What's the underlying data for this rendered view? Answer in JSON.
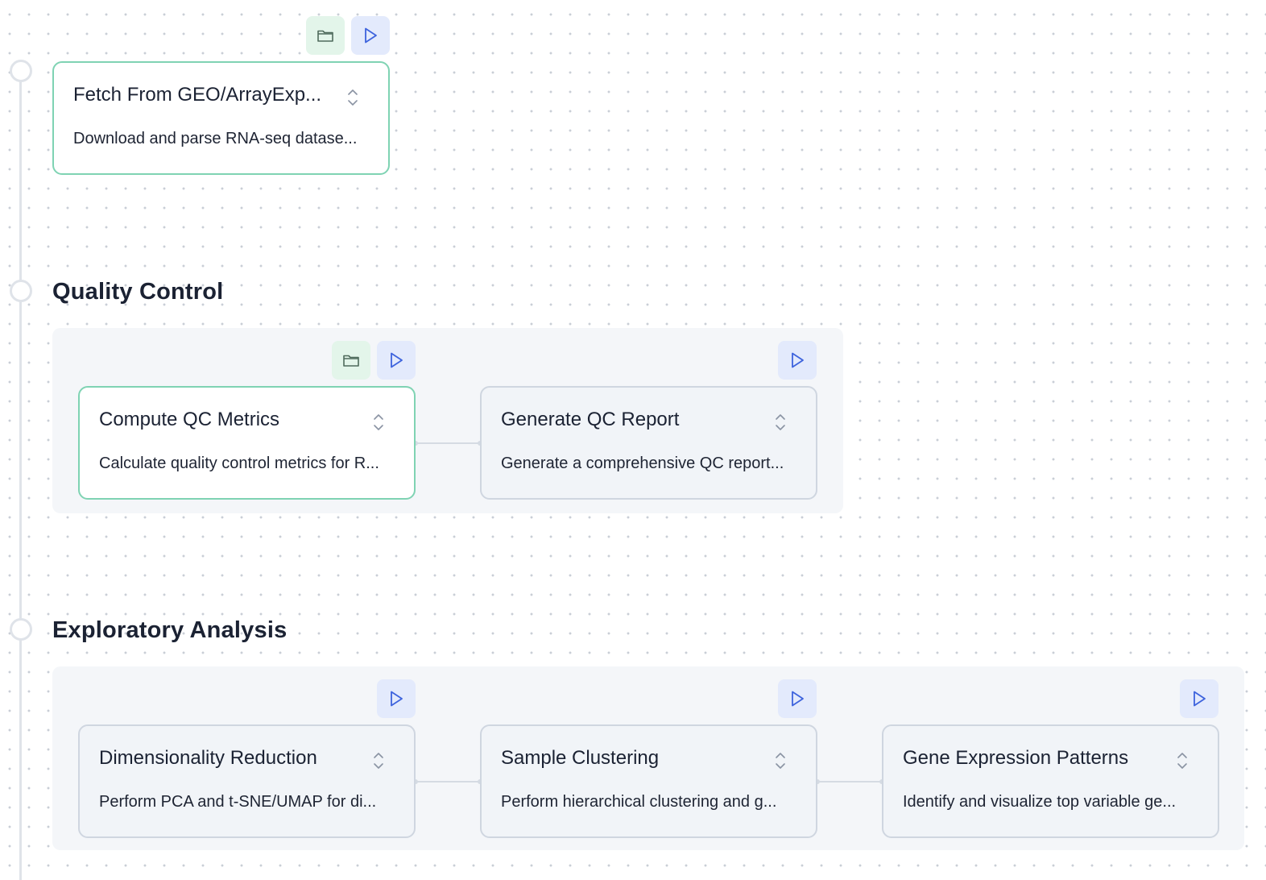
{
  "stages": [
    {
      "title": "",
      "cards": [
        {
          "title": "Fetch From GEO/ArrayExp...",
          "description": "Download and parse RNA-seq datase...",
          "active": true,
          "has_folder": true
        }
      ]
    },
    {
      "title": "Quality Control",
      "cards": [
        {
          "title": "Compute QC Metrics",
          "description": "Calculate quality control metrics for R...",
          "active": true,
          "has_folder": true
        },
        {
          "title": "Generate QC Report",
          "description": "Generate a comprehensive QC report...",
          "active": false,
          "has_folder": false
        }
      ]
    },
    {
      "title": "Exploratory Analysis",
      "cards": [
        {
          "title": "Dimensionality Reduction",
          "description": "Perform PCA and t-SNE/UMAP for di...",
          "active": false,
          "has_folder": false
        },
        {
          "title": "Sample Clustering",
          "description": "Perform hierarchical clustering and g...",
          "active": false,
          "has_folder": false
        },
        {
          "title": "Gene Expression Patterns",
          "description": "Identify and visualize top variable ge...",
          "active": false,
          "has_folder": false
        }
      ]
    }
  ],
  "icons": {
    "folder": "folder-icon",
    "run": "play-icon",
    "expand": "chevron-up-down-icon"
  },
  "colors": {
    "active_border": "#7fd3b3",
    "folder_button_bg": "#e3f5ea",
    "run_button_bg": "#e3eafc",
    "run_icon": "#3d63dd",
    "folder_icon": "#4f6b5c"
  }
}
